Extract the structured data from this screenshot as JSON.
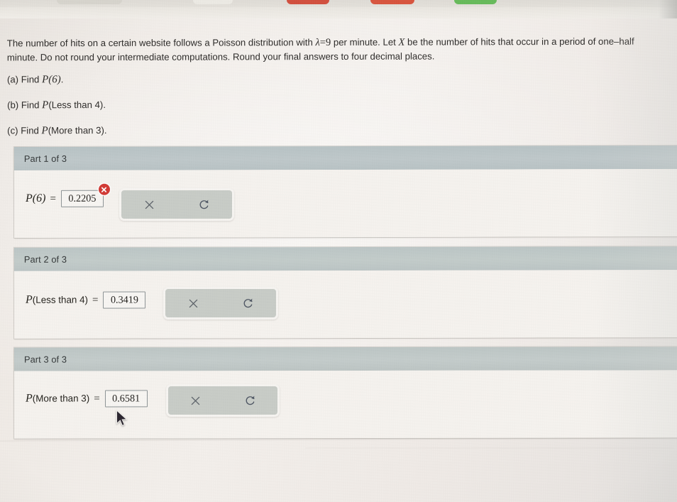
{
  "browser": {
    "tabs": [
      {
        "name": "tab-1",
        "color": "#d7d4cd"
      },
      {
        "name": "tab-2",
        "color": "#eceae4"
      },
      {
        "name": "tab-3",
        "color": "#d2503f"
      },
      {
        "name": "tab-4",
        "color": "#d8553f"
      },
      {
        "name": "tab-5",
        "color": "#68bb5c"
      }
    ]
  },
  "problem": {
    "statement_part1": "The number of hits on a certain website follows a Poisson distribution with ",
    "lambda_symbol": "λ",
    "lambda_equals": "=9",
    "statement_part2": " per minute. Let ",
    "random_var": "X",
    "statement_part3": " be the number of hits that occur in a period of one–half minute. Do not round your intermediate computations. Round your final answers to four decimal places.",
    "prompts": [
      {
        "id": "prompt-a",
        "label": "(a) Find ",
        "math_p": "P",
        "math_arg": "(6)",
        "trailing": "."
      },
      {
        "id": "prompt-b",
        "label": "(b) Find ",
        "math_p": "P",
        "math_arg": "(Less than 4)",
        "trailing": "."
      },
      {
        "id": "prompt-c",
        "label": "(c) Find ",
        "math_p": "P",
        "math_arg": "(More than 3)",
        "trailing": "."
      }
    ]
  },
  "parts": [
    {
      "id": "part-1",
      "header": "Part 1 of 3",
      "expr_p": "P",
      "expr_arg": "(6)",
      "expr_arg_roman": "",
      "equals": "=",
      "value": "0.2205",
      "has_error": true,
      "error_icon": "error-x-circle-icon",
      "buttons": [
        {
          "name": "clear-button",
          "icon": "x-icon",
          "label": "×"
        },
        {
          "name": "undo-button",
          "icon": "undo-arrow-icon",
          "label": "↺"
        }
      ]
    },
    {
      "id": "part-2",
      "header": "Part 2 of 3",
      "expr_p": "P",
      "expr_arg": "(",
      "expr_arg_roman": "Less than 4",
      "equals": "=",
      "value": "0.3419",
      "has_error": false,
      "error_icon": "",
      "buttons": [
        {
          "name": "clear-button",
          "icon": "x-icon",
          "label": "×"
        },
        {
          "name": "undo-button",
          "icon": "undo-arrow-icon",
          "label": "↺"
        }
      ]
    },
    {
      "id": "part-3",
      "header": "Part 3 of 3",
      "expr_p": "P",
      "expr_arg": "(",
      "expr_arg_roman": "More than 3",
      "equals": "=",
      "value": "0.6581",
      "has_error": false,
      "error_icon": "",
      "buttons": [
        {
          "name": "clear-button",
          "icon": "x-icon",
          "label": "×"
        },
        {
          "name": "undo-button",
          "icon": "undo-arrow-icon",
          "label": "↺"
        }
      ]
    }
  ],
  "colors": {
    "error_red": "#d23b36",
    "header_gray": "#bfc8ca",
    "card_bg": "#f4f1ed",
    "button_bg": "#c8ccc7",
    "page_bg": "#efebe6"
  },
  "cursor": {
    "icon": "mouse-pointer-icon"
  }
}
